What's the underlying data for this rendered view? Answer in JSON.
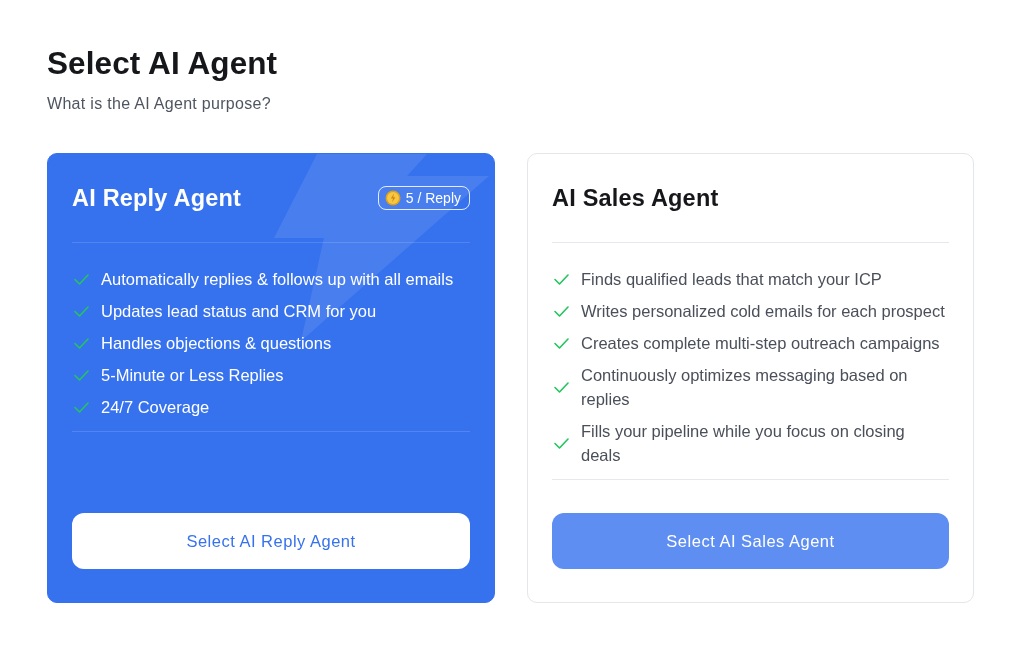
{
  "page": {
    "title": "Select AI Agent",
    "subtitle": "What is the AI Agent purpose?"
  },
  "agents": [
    {
      "name": "AI Reply Agent",
      "selected": true,
      "badge": {
        "label": "5 / Reply"
      },
      "features": [
        "Automatically replies & follows up with all emails",
        "Updates lead status and CRM for you",
        "Handles objections & questions",
        "5-Minute or Less Replies",
        "24/7 Coverage"
      ],
      "button": "Select AI Reply Agent"
    },
    {
      "name": "AI Sales Agent",
      "selected": false,
      "features": [
        "Finds qualified leads that match your ICP",
        "Writes personalized cold emails for each prospect",
        "Creates complete multi-step outreach campaigns",
        "Continuously optimizes messaging based on replies",
        "Fills your pipeline while you focus on closing deals"
      ],
      "button": "Select AI Sales Agent"
    }
  ]
}
